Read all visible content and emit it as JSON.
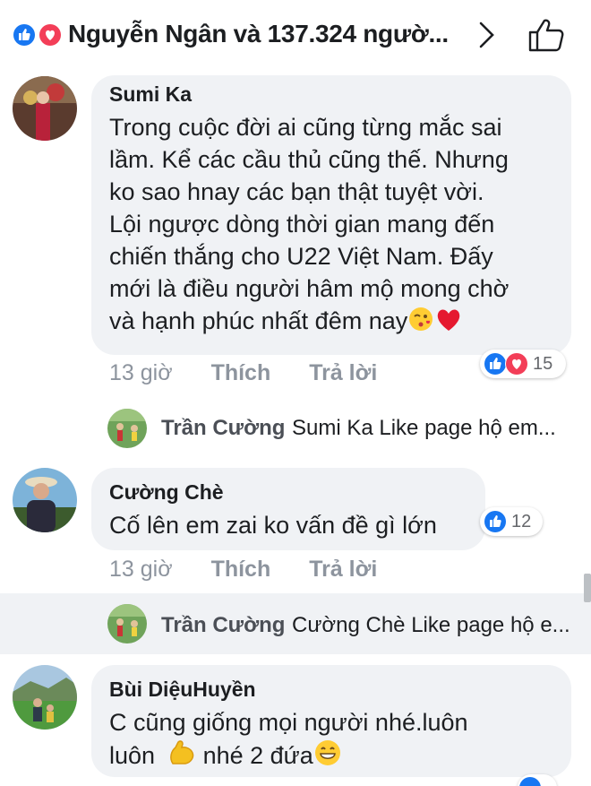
{
  "header": {
    "title": "Nguyễn Ngân và 137.324 ngườ...",
    "like_color": "#1877f2",
    "love_color": "#f33e58"
  },
  "comments": [
    {
      "author": "Sumi Ka",
      "lines": [
        "Trong cuộc đời ai cũng từng mắc sai",
        "lầm. Kể các cầu thủ cũng thế. Nhưng",
        "ko sao hnay các bạn thật tuyệt vời.",
        "Lội ngược dòng thời gian mang đến",
        "chiến thắng cho U22 Việt Nam. Đấy",
        "mới là điều người hâm mộ mong chờ",
        "và hạnh phúc nhất đêm nay"
      ],
      "time": "13 giờ",
      "like_label": "Thích",
      "reply_label": "Trả lời",
      "reactions": [
        "like-icon",
        "love-icon"
      ],
      "reaction_count": "15"
    },
    {
      "author": "Cường Chè",
      "lines": [
        "Cố lên em zai ko vấn đề gì lớn"
      ],
      "time": "13 giờ",
      "like_label": "Thích",
      "reply_label": "Trả lời",
      "reactions": [
        "like-icon"
      ],
      "reaction_count": "12"
    },
    {
      "author": "Bùi DiệuHuyền",
      "lines": [
        "C cũng giống mọi người nhé.luôn",
        "luôn",
        "nhé 2 đứa"
      ]
    }
  ],
  "replies": [
    {
      "author": "Trần Cường",
      "text": "Sumi Ka   Like page hộ em..."
    },
    {
      "author": "Trần Cường",
      "text": "Cường Chè Like page hộ e..."
    }
  ]
}
